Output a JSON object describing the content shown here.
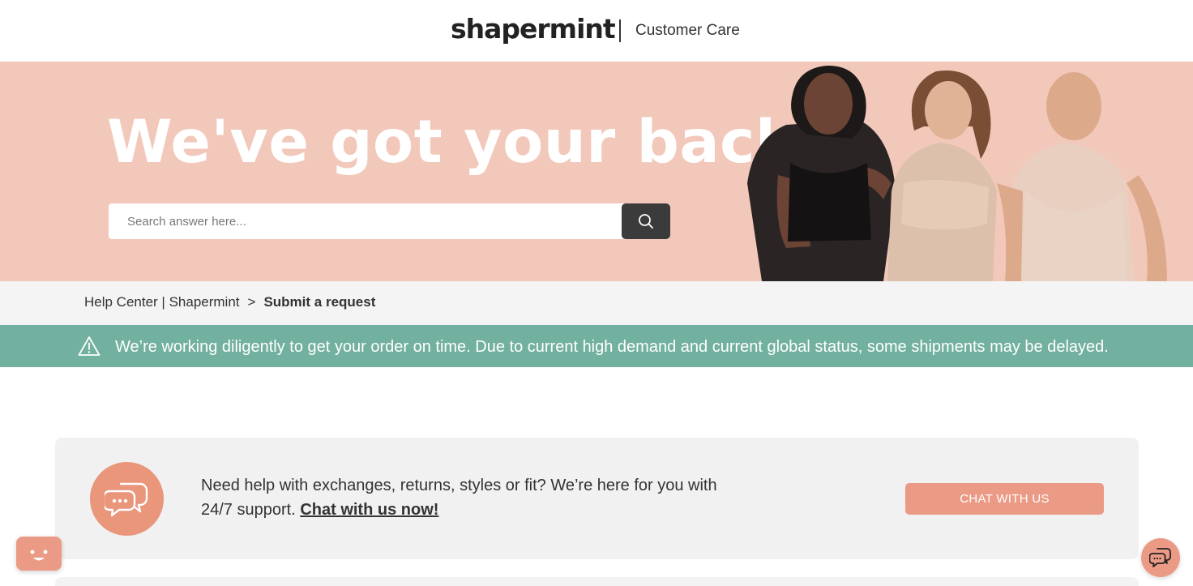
{
  "header": {
    "logo": "shapermint",
    "subtitle": "Customer Care"
  },
  "hero": {
    "title": "We've got your back",
    "search_placeholder": "Search answer here..."
  },
  "breadcrumb": {
    "home": "Help Center | Shapermint",
    "separator": ">",
    "current": "Submit a request"
  },
  "notice": {
    "text": "We’re working diligently to get your order on time. Due to current high demand and current global status, some shipments may be delayed."
  },
  "help_card": {
    "text": "Need help with exchanges, returns, styles or fit? We’re here for you with 24/7 support.",
    "link": "Chat with us now!",
    "button": "CHAT WITH US"
  },
  "icons": {
    "search": "search-icon",
    "warning": "warning-icon",
    "chat_bubbles": "chat-bubbles-icon",
    "bot": "bot-face-icon",
    "chat_fab": "chat-icon"
  },
  "colors": {
    "hero_bg": "#f2c8ba",
    "accent": "#eb9b85",
    "notice_bg": "#72b09f",
    "search_button": "#3b3b3b",
    "card_bg": "#f1f1f1"
  }
}
